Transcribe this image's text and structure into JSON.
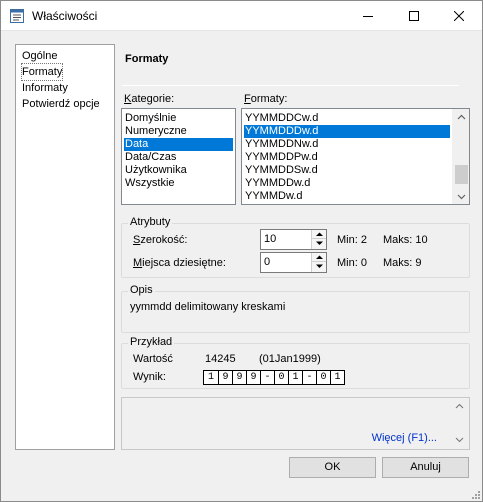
{
  "window": {
    "title": "Właściwości"
  },
  "nav": {
    "items": [
      "Ogólne",
      "Formaty",
      "Informaty",
      "Potwierdź opcje"
    ],
    "selected_index": 1
  },
  "section": {
    "title": "Formaty"
  },
  "categories": {
    "label_underlined": "K",
    "label_rest": "ategorie:",
    "items": [
      "Domyślnie",
      "Numeryczne",
      "Data",
      "Data/Czas",
      "Użytkownika",
      "Wszystkie"
    ],
    "selected_index": 2
  },
  "formats": {
    "label_underlined": "F",
    "label_rest": "ormaty:",
    "items": [
      "YYMMDDCw.d",
      "YYMMDDDw.d",
      "YYMMDDNw.d",
      "YYMMDDPw.d",
      "YYMMDDSw.d",
      "YYMMDDw.d",
      "YYMMDw.d"
    ],
    "selected_index": 1
  },
  "attributes": {
    "group_title": "Atrybuty",
    "width_label_underlined": "S",
    "width_label_rest": "zerokość:",
    "width_value": "10",
    "width_min": "Min:  2",
    "width_max": "Maks:  10",
    "decimals_label_underlined": "M",
    "decimals_label_rest": "iejsca dziesiętne:",
    "decimals_value": "0",
    "decimals_min": "Min:  0",
    "decimals_max": "Maks:  9"
  },
  "description": {
    "group_title": "Opis",
    "text": "yymmdd delimitowany kreskami"
  },
  "example": {
    "group_title": "Przykład",
    "value_label": "Wartość",
    "value": "14245",
    "value_date": "(01Jan1999)",
    "result_label": "Wynik:",
    "result_chars": [
      "1",
      "9",
      "9",
      "9",
      "-",
      "0",
      "1",
      "-",
      "0",
      "1"
    ]
  },
  "more_link": "Więcej (F1)...",
  "buttons": {
    "ok": "OK",
    "cancel": "Anuluj"
  },
  "colors": {
    "selection": "#0078d7",
    "link": "#0033cc"
  }
}
